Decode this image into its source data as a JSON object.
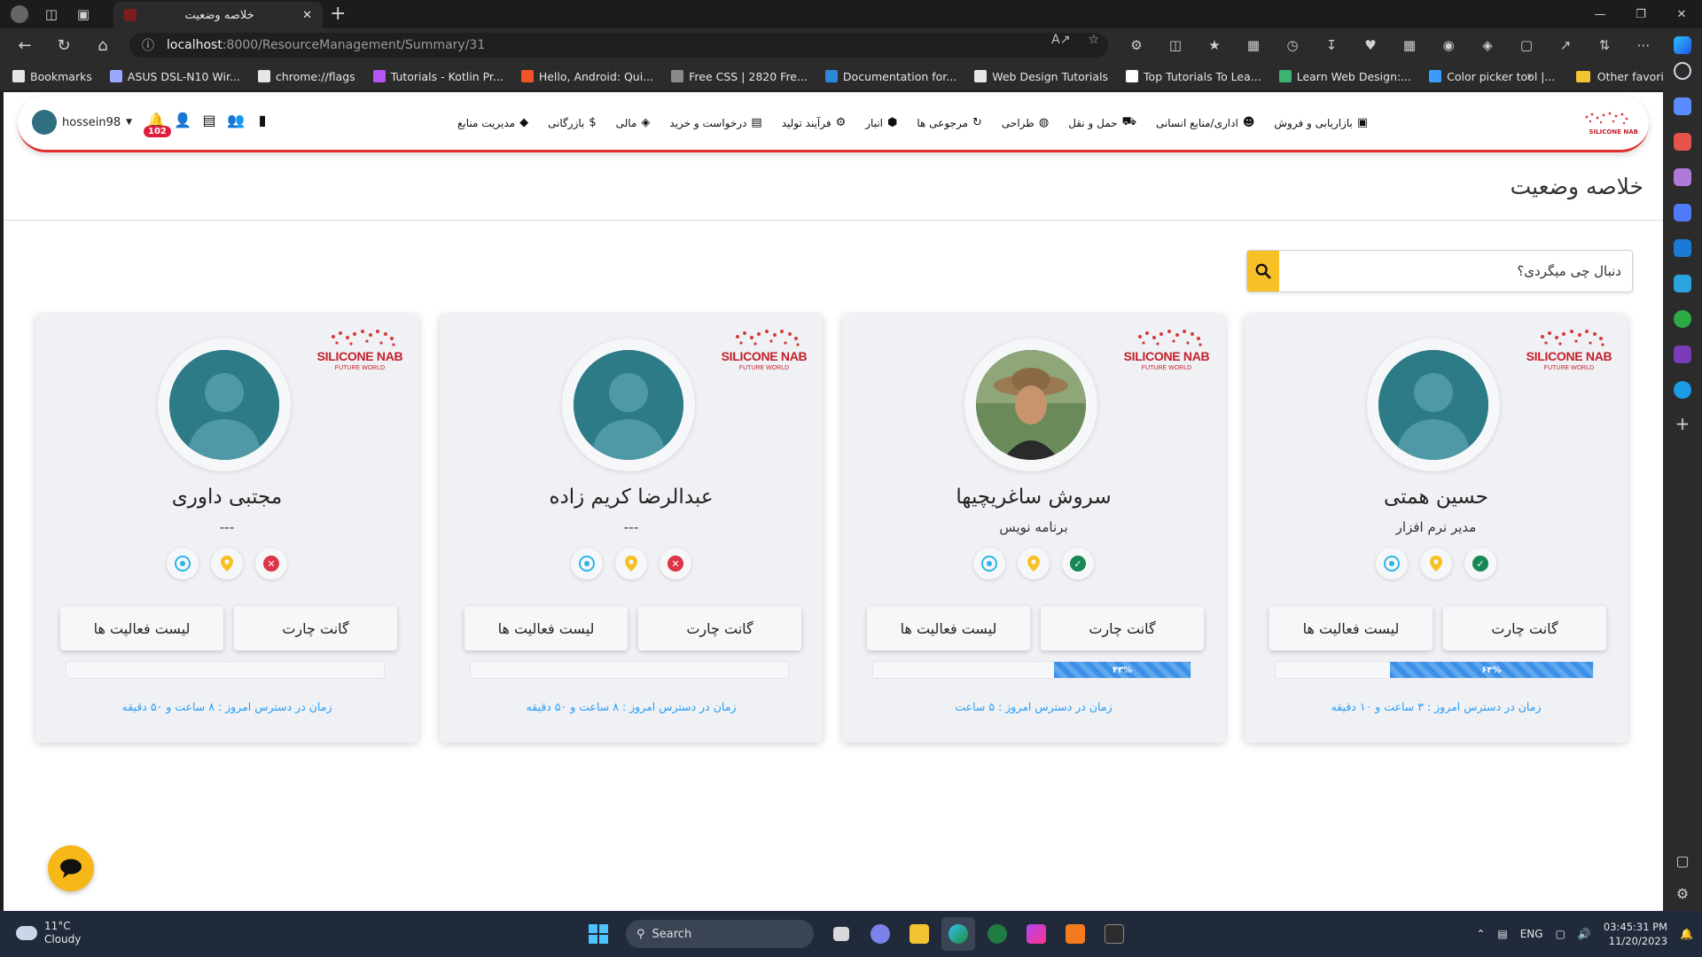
{
  "browser": {
    "tab_title": "خلاصه وضعیت",
    "url_host": "localhost",
    "url_rest": ":8000/ResourceManagement/Summary/31",
    "bookmarks": [
      {
        "label": "Bookmarks",
        "color": "#e6e6e6"
      },
      {
        "label": "ASUS DSL-N10 Wir...",
        "color": "#9aa8ff"
      },
      {
        "label": "chrome://flags",
        "color": "#e6e6e6"
      },
      {
        "label": "Tutorials - Kotlin Pr...",
        "color": "#b455f5"
      },
      {
        "label": "Hello, Android: Qui...",
        "color": "#f35325"
      },
      {
        "label": "Free CSS | 2820 Fre...",
        "color": "#8a8a8a"
      },
      {
        "label": "Documentation for...",
        "color": "#2b88d8"
      },
      {
        "label": "Web Design Tutorials",
        "color": "#e6e6e6"
      },
      {
        "label": "Top Tutorials To Lea...",
        "color": "#ffffff"
      },
      {
        "label": "Learn Web Design:...",
        "color": "#3cb371"
      },
      {
        "label": "Color picker tool |...",
        "color": "#3b9cff"
      }
    ],
    "other_favorites": "Other favorites"
  },
  "header": {
    "username": "hossein98",
    "notification_count": "102",
    "menu": [
      {
        "label": "بازاریابی و فروش",
        "icon": "ad-icon"
      },
      {
        "label": "اداری/منابع انسانی",
        "icon": "people-icon"
      },
      {
        "label": "حمل و نقل",
        "icon": "truck-icon"
      },
      {
        "label": "طراحی",
        "icon": "palette-icon"
      },
      {
        "label": "مرجوعی ها",
        "icon": "return-icon"
      },
      {
        "label": "انبار",
        "icon": "box-icon"
      },
      {
        "label": "فرآیند تولید",
        "icon": "production-icon"
      },
      {
        "label": "درخواست و خرید",
        "icon": "clipboard-icon"
      },
      {
        "label": "مالی",
        "icon": "finance-icon"
      },
      {
        "label": "بازرگانی",
        "icon": "dollar-icon"
      },
      {
        "label": "مدیریت منابع",
        "icon": "diamond-icon"
      }
    ]
  },
  "page": {
    "title": "خلاصه وضعیت",
    "search_placeholder": "دنبال چی میگردی؟",
    "brand_name": "SILICONE NAB",
    "brand_tagline": "FUTURE WORLD"
  },
  "cards": [
    {
      "name": "حسین همتی",
      "role": "مدیر نرم افزار",
      "status": "present",
      "status_color": "#198754",
      "gantt_label": "گانت چارت",
      "list_label": "لیست فعالیت ها",
      "progress_label": "۶۴%",
      "progress": 0.64,
      "time_text": "زمان در دسترس امروز : ۳ ساعت و ۱۰ دقیقه",
      "has_photo": false
    },
    {
      "name": "سروش ساغریچیها",
      "role": "برنامه نویس",
      "status": "present",
      "status_color": "#198754",
      "gantt_label": "گانت چارت",
      "list_label": "لیست فعالیت ها",
      "progress_label": "۴۳%",
      "progress": 0.43,
      "time_text": "زمان در دسترس امروز : ۵ ساعت",
      "has_photo": true
    },
    {
      "name": "عبدالرضا کریم زاده",
      "role": "---",
      "status": "absent",
      "status_color": "#dc3545",
      "gantt_label": "گانت چارت",
      "list_label": "لیست فعالیت ها",
      "progress_label": "",
      "progress": 0,
      "time_text": "زمان در دسترس امروز : ۸ ساعت و ۵۰ دقیقه",
      "has_photo": false
    },
    {
      "name": "مجتبی داوری",
      "role": "---",
      "status": "absent",
      "status_color": "#dc3545",
      "gantt_label": "گانت چارت",
      "list_label": "لیست فعالیت ها",
      "progress_label": "",
      "progress": 0,
      "time_text": "زمان در دسترس امروز : ۸ ساعت و ۵۰ دقیقه",
      "has_photo": false
    }
  ],
  "taskbar": {
    "temperature": "11°C",
    "weather": "Cloudy",
    "search_label": "Search",
    "lang": "ENG",
    "time": "03:45:31 PM",
    "date": "11/20/2023"
  },
  "colors": {
    "accent": "#f6c026",
    "brand_red": "#e03030",
    "link_blue": "#2a9df4"
  }
}
